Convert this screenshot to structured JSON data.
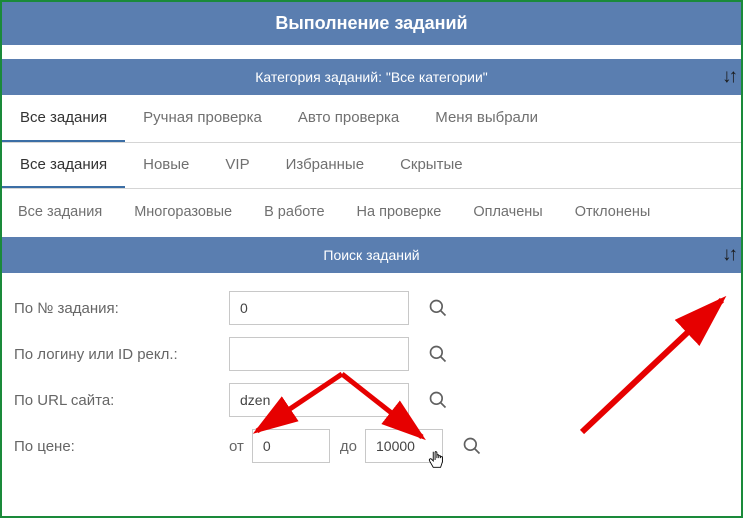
{
  "header": {
    "title": "Выполнение заданий"
  },
  "category_header": {
    "text": "Категория заданий: \"Все категории\""
  },
  "tabs_row1": {
    "items": [
      {
        "label": "Все задания",
        "active": true
      },
      {
        "label": "Ручная проверка",
        "active": false
      },
      {
        "label": "Авто проверка",
        "active": false
      },
      {
        "label": "Меня выбрали",
        "active": false
      }
    ]
  },
  "tabs_row2": {
    "items": [
      {
        "label": "Все задания",
        "active": true
      },
      {
        "label": "Новые",
        "active": false
      },
      {
        "label": "VIP",
        "active": false
      },
      {
        "label": "Избранные",
        "active": false
      },
      {
        "label": "Скрытые",
        "active": false
      }
    ]
  },
  "tabs_row3": {
    "items": [
      {
        "label": "Все задания",
        "active": false
      },
      {
        "label": "Многоразовые",
        "active": false
      },
      {
        "label": "В работе",
        "active": false
      },
      {
        "label": "На проверке",
        "active": false
      },
      {
        "label": "Оплачены",
        "active": false
      },
      {
        "label": "Отклонены",
        "active": false
      }
    ]
  },
  "search": {
    "header": "Поиск заданий",
    "by_number": {
      "label": "По № задания:",
      "value": "0"
    },
    "by_login": {
      "label": "По логину или ID рекл.:",
      "value": ""
    },
    "by_url": {
      "label": "По URL сайта:",
      "value": "dzen"
    },
    "by_price": {
      "label": "По цене:",
      "from_label": "от",
      "from": "0",
      "to_label": "до",
      "to": "10000"
    }
  }
}
